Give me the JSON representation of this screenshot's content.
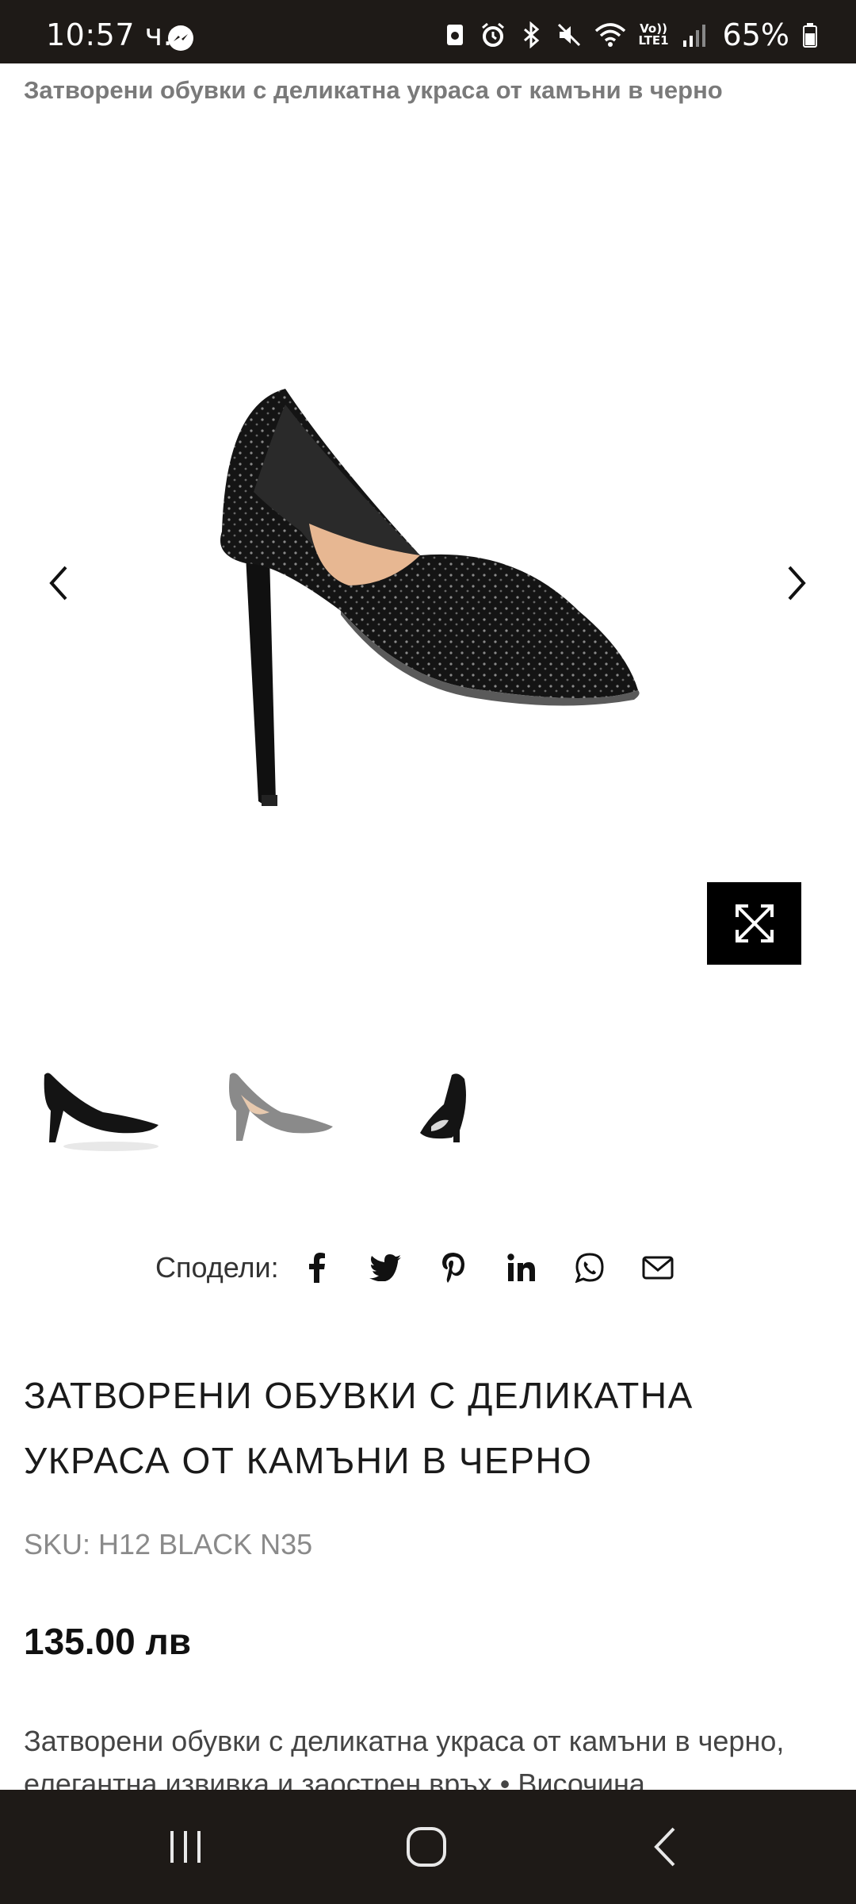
{
  "status_bar": {
    "time": "10:57 ч.",
    "battery": "65%",
    "network": "LTE1",
    "volte": "Vo))",
    "icons": [
      "messenger-icon",
      "recycle-icon",
      "alarm-icon",
      "bluetooth-icon",
      "mute-icon",
      "wifi-icon",
      "signal-icon",
      "battery-icon"
    ]
  },
  "page": {
    "breadcrumb_title": "Затворени обувки с деликатна украса от камъни в черно"
  },
  "gallery": {
    "prev_icon": "chevron-left-icon",
    "next_icon": "chevron-right-icon",
    "zoom_icon": "expand-icon",
    "thumbnails": [
      "thumbnail-side-view",
      "thumbnail-grey-view",
      "thumbnail-back-view"
    ]
  },
  "share": {
    "label": "Сподели:",
    "networks": [
      "facebook-icon",
      "twitter-icon",
      "pinterest-icon",
      "linkedin-icon",
      "whatsapp-icon",
      "email-icon"
    ]
  },
  "product": {
    "title": "ЗАТВОРЕНИ ОБУВКИ С ДЕЛИКАТНА УКРАСА ОТ КАМЪНИ В ЧЕРНО",
    "sku": "SKU: H12 BLACK N35",
    "price": "135.00 лв",
    "description": "Затворени обувки с деликатна украса от камъни в черно, елегантна извивка и заострен връх • Височина"
  },
  "nav_bar": {
    "buttons": [
      "recent-apps-icon",
      "home-icon",
      "back-icon"
    ]
  }
}
